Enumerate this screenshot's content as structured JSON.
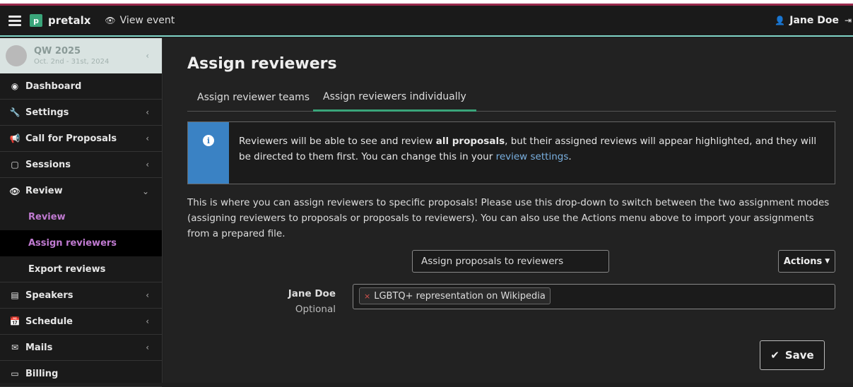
{
  "navbar": {
    "brand": "pretalx",
    "logo_letter": "p",
    "view_event": "View event",
    "user": "Jane Doe"
  },
  "sidebar": {
    "event_name": "QW 2025",
    "event_dates": "Oct. 2nd - 31st, 2024",
    "items": [
      {
        "label": "Dashboard",
        "icon": "dashboard-icon"
      },
      {
        "label": "Settings",
        "icon": "wrench-icon"
      },
      {
        "label": "Call for Proposals",
        "icon": "bullhorn-icon"
      },
      {
        "label": "Sessions",
        "icon": "sticky-note-icon"
      },
      {
        "label": "Review",
        "icon": "eye-icon"
      },
      {
        "label": "Speakers",
        "icon": "id-card-icon"
      },
      {
        "label": "Schedule",
        "icon": "calendar-icon"
      },
      {
        "label": "Mails",
        "icon": "envelope-icon"
      },
      {
        "label": "Billing",
        "icon": "credit-card-icon"
      }
    ],
    "review_sub": [
      "Review",
      "Assign reviewers",
      "Export reviews"
    ]
  },
  "main": {
    "title": "Assign reviewers",
    "tabs": [
      "Assign reviewer teams",
      "Assign reviewers individually"
    ],
    "alert": {
      "part1": "Reviewers will be able to see and review ",
      "bold": "all proposals",
      "part2": ", but their assigned reviews will appear highlighted, and they will be directed to them first. You can change this in your ",
      "link": "review settings",
      "part3": "."
    },
    "description": "This is where you can assign reviewers to specific proposals! Please use this drop-down to switch between the two assignment modes (assigning reviewers to proposals or proposals to reviewers). You can also use the Actions menu above to import your assignments from a prepared file.",
    "mode_select": "Assign proposals to reviewers",
    "actions_label": "Actions",
    "reviewer": {
      "name": "Jane Doe",
      "optional": "Optional",
      "tags": [
        "LGBTQ+ representation on Wikipedia"
      ]
    },
    "save_label": "Save"
  },
  "colors": {
    "accent_green": "#3aa57a",
    "info_blue": "#3a82c4",
    "active_purple": "#c07ad1",
    "top_border": "#9b2a4d",
    "navbar_underline": "#7fd3c7"
  }
}
